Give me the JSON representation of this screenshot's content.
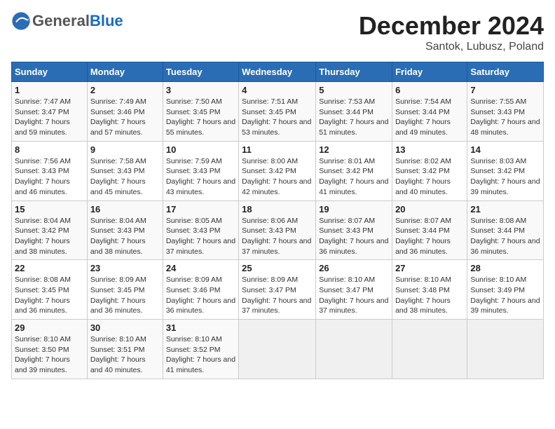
{
  "header": {
    "logo": {
      "general": "General",
      "blue": "Blue"
    },
    "title": "December 2024",
    "location": "Santok, Lubusz, Poland"
  },
  "weekdays": [
    "Sunday",
    "Monday",
    "Tuesday",
    "Wednesday",
    "Thursday",
    "Friday",
    "Saturday"
  ],
  "weeks": [
    [
      {
        "day": "1",
        "sunrise": "Sunrise: 7:47 AM",
        "sunset": "Sunset: 3:47 PM",
        "daylight": "Daylight: 7 hours and 59 minutes."
      },
      {
        "day": "2",
        "sunrise": "Sunrise: 7:49 AM",
        "sunset": "Sunset: 3:46 PM",
        "daylight": "Daylight: 7 hours and 57 minutes."
      },
      {
        "day": "3",
        "sunrise": "Sunrise: 7:50 AM",
        "sunset": "Sunset: 3:45 PM",
        "daylight": "Daylight: 7 hours and 55 minutes."
      },
      {
        "day": "4",
        "sunrise": "Sunrise: 7:51 AM",
        "sunset": "Sunset: 3:45 PM",
        "daylight": "Daylight: 7 hours and 53 minutes."
      },
      {
        "day": "5",
        "sunrise": "Sunrise: 7:53 AM",
        "sunset": "Sunset: 3:44 PM",
        "daylight": "Daylight: 7 hours and 51 minutes."
      },
      {
        "day": "6",
        "sunrise": "Sunrise: 7:54 AM",
        "sunset": "Sunset: 3:44 PM",
        "daylight": "Daylight: 7 hours and 49 minutes."
      },
      {
        "day": "7",
        "sunrise": "Sunrise: 7:55 AM",
        "sunset": "Sunset: 3:43 PM",
        "daylight": "Daylight: 7 hours and 48 minutes."
      }
    ],
    [
      {
        "day": "8",
        "sunrise": "Sunrise: 7:56 AM",
        "sunset": "Sunset: 3:43 PM",
        "daylight": "Daylight: 7 hours and 46 minutes."
      },
      {
        "day": "9",
        "sunrise": "Sunrise: 7:58 AM",
        "sunset": "Sunset: 3:43 PM",
        "daylight": "Daylight: 7 hours and 45 minutes."
      },
      {
        "day": "10",
        "sunrise": "Sunrise: 7:59 AM",
        "sunset": "Sunset: 3:43 PM",
        "daylight": "Daylight: 7 hours and 43 minutes."
      },
      {
        "day": "11",
        "sunrise": "Sunrise: 8:00 AM",
        "sunset": "Sunset: 3:42 PM",
        "daylight": "Daylight: 7 hours and 42 minutes."
      },
      {
        "day": "12",
        "sunrise": "Sunrise: 8:01 AM",
        "sunset": "Sunset: 3:42 PM",
        "daylight": "Daylight: 7 hours and 41 minutes."
      },
      {
        "day": "13",
        "sunrise": "Sunrise: 8:02 AM",
        "sunset": "Sunset: 3:42 PM",
        "daylight": "Daylight: 7 hours and 40 minutes."
      },
      {
        "day": "14",
        "sunrise": "Sunrise: 8:03 AM",
        "sunset": "Sunset: 3:42 PM",
        "daylight": "Daylight: 7 hours and 39 minutes."
      }
    ],
    [
      {
        "day": "15",
        "sunrise": "Sunrise: 8:04 AM",
        "sunset": "Sunset: 3:42 PM",
        "daylight": "Daylight: 7 hours and 38 minutes."
      },
      {
        "day": "16",
        "sunrise": "Sunrise: 8:04 AM",
        "sunset": "Sunset: 3:43 PM",
        "daylight": "Daylight: 7 hours and 38 minutes."
      },
      {
        "day": "17",
        "sunrise": "Sunrise: 8:05 AM",
        "sunset": "Sunset: 3:43 PM",
        "daylight": "Daylight: 7 hours and 37 minutes."
      },
      {
        "day": "18",
        "sunrise": "Sunrise: 8:06 AM",
        "sunset": "Sunset: 3:43 PM",
        "daylight": "Daylight: 7 hours and 37 minutes."
      },
      {
        "day": "19",
        "sunrise": "Sunrise: 8:07 AM",
        "sunset": "Sunset: 3:43 PM",
        "daylight": "Daylight: 7 hours and 36 minutes."
      },
      {
        "day": "20",
        "sunrise": "Sunrise: 8:07 AM",
        "sunset": "Sunset: 3:44 PM",
        "daylight": "Daylight: 7 hours and 36 minutes."
      },
      {
        "day": "21",
        "sunrise": "Sunrise: 8:08 AM",
        "sunset": "Sunset: 3:44 PM",
        "daylight": "Daylight: 7 hours and 36 minutes."
      }
    ],
    [
      {
        "day": "22",
        "sunrise": "Sunrise: 8:08 AM",
        "sunset": "Sunset: 3:45 PM",
        "daylight": "Daylight: 7 hours and 36 minutes."
      },
      {
        "day": "23",
        "sunrise": "Sunrise: 8:09 AM",
        "sunset": "Sunset: 3:45 PM",
        "daylight": "Daylight: 7 hours and 36 minutes."
      },
      {
        "day": "24",
        "sunrise": "Sunrise: 8:09 AM",
        "sunset": "Sunset: 3:46 PM",
        "daylight": "Daylight: 7 hours and 36 minutes."
      },
      {
        "day": "25",
        "sunrise": "Sunrise: 8:09 AM",
        "sunset": "Sunset: 3:47 PM",
        "daylight": "Daylight: 7 hours and 37 minutes."
      },
      {
        "day": "26",
        "sunrise": "Sunrise: 8:10 AM",
        "sunset": "Sunset: 3:47 PM",
        "daylight": "Daylight: 7 hours and 37 minutes."
      },
      {
        "day": "27",
        "sunrise": "Sunrise: 8:10 AM",
        "sunset": "Sunset: 3:48 PM",
        "daylight": "Daylight: 7 hours and 38 minutes."
      },
      {
        "day": "28",
        "sunrise": "Sunrise: 8:10 AM",
        "sunset": "Sunset: 3:49 PM",
        "daylight": "Daylight: 7 hours and 39 minutes."
      }
    ],
    [
      {
        "day": "29",
        "sunrise": "Sunrise: 8:10 AM",
        "sunset": "Sunset: 3:50 PM",
        "daylight": "Daylight: 7 hours and 39 minutes."
      },
      {
        "day": "30",
        "sunrise": "Sunrise: 8:10 AM",
        "sunset": "Sunset: 3:51 PM",
        "daylight": "Daylight: 7 hours and 40 minutes."
      },
      {
        "day": "31",
        "sunrise": "Sunrise: 8:10 AM",
        "sunset": "Sunset: 3:52 PM",
        "daylight": "Daylight: 7 hours and 41 minutes."
      },
      null,
      null,
      null,
      null
    ]
  ]
}
